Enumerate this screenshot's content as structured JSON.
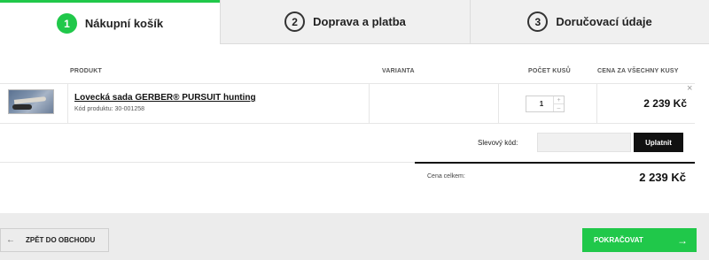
{
  "steps": [
    {
      "number": "1",
      "label": "Nákupní košík"
    },
    {
      "number": "2",
      "label": "Doprava a platba"
    },
    {
      "number": "3",
      "label": "Doručovací údaje"
    }
  ],
  "table": {
    "headers": {
      "product": "PRODUKT",
      "variant": "VARIANTA",
      "quantity": "POČET KUSŮ",
      "price": "CENA ZA VŠECHNY KUSY"
    },
    "item": {
      "name": "Lovecká sada GERBER® PURSUIT hunting",
      "code": "Kód produktu: 30-001258",
      "variant": "",
      "quantity": "1",
      "qty_plus": "+",
      "qty_minus": "–",
      "price": "2 239 Kč",
      "remove": "×"
    }
  },
  "discount": {
    "label": "Slevový kód:",
    "placeholder": "",
    "value": "",
    "button": "Uplatnit"
  },
  "summary": {
    "label": "Cena celkem:",
    "value": "2 239 Kč"
  },
  "footer": {
    "back_arrow": "←",
    "back_label": "ZPĚT DO OBCHODU",
    "continue_label": "POKRAČOVAT",
    "continue_arrow": "→"
  },
  "colors": {
    "accent": "#20c84a",
    "dark_button": "#111111",
    "footer_bg": "#ececec"
  }
}
